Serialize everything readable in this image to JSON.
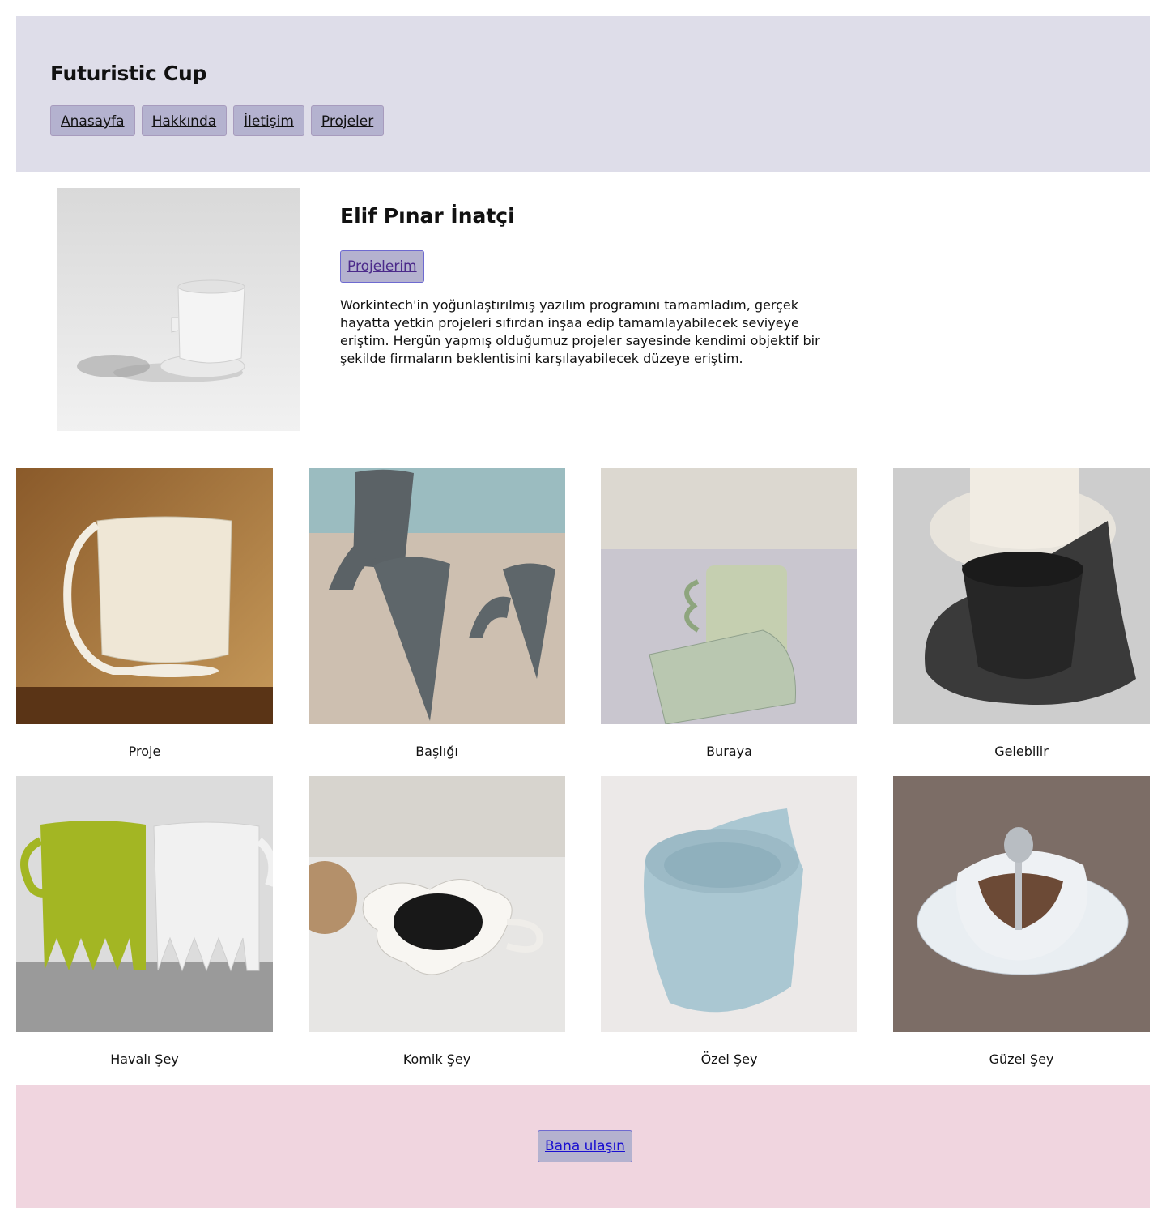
{
  "header": {
    "title": "Futuristic Cup",
    "nav": [
      {
        "label": "Anasayfa"
      },
      {
        "label": "Hakkında"
      },
      {
        "label": "İletişim"
      },
      {
        "label": "Projeler"
      }
    ],
    "background": "#dedde9"
  },
  "profile": {
    "name": "Elif Pınar İnatçi",
    "button_label": "Projelerim",
    "bio": "Workintech'in yoğunlaştırılmış yazılım programını tamamladım, gerçek hayatta yetkin projeleri sıfırdan inşaa edip tamamlayabilecek seviyeye eriştim. Hergün yapmış olduğumuz projeler sayesinde kendimi objektif bir şekilde firmaların beklentisini karşılayabilecek düzeye eriştim."
  },
  "projects": [
    {
      "title": "Proje"
    },
    {
      "title": "Başlığı"
    },
    {
      "title": "Buraya"
    },
    {
      "title": "Gelebilir"
    },
    {
      "title": "Havalı Şey"
    },
    {
      "title": "Komik Şey"
    },
    {
      "title": "Özel Şey"
    },
    {
      "title": "Güzel Şey"
    }
  ],
  "footer": {
    "button_label": "Bana ulaşın",
    "background": "#f0d5df"
  },
  "colors": {
    "button_bg": "#b4b2cf",
    "button_border": "#6e6ad0",
    "link": "#1a0fd1"
  }
}
